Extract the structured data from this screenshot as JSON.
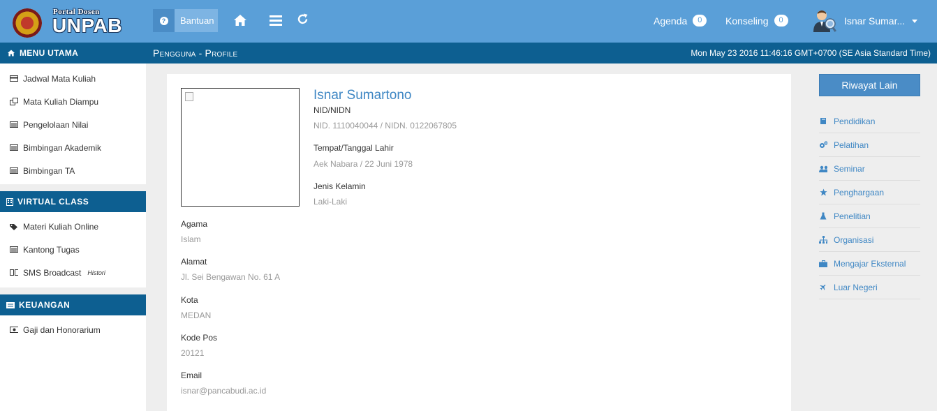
{
  "header": {
    "logo_top": "Portal Dosen",
    "logo_main": "UNPAB",
    "help_label": "Bantuan",
    "agenda_label": "Agenda",
    "agenda_count": "0",
    "konseling_label": "Konseling",
    "konseling_count": "0",
    "user_name": "Isnar Sumar..."
  },
  "subbar": {
    "menu_title": "MENU UTAMA",
    "page_title_a": "Pengguna",
    "page_title_sep": " - ",
    "page_title_b": "Profile",
    "datetime": "Mon May 23 2016 11:46:16 GMT+0700 (SE Asia Standard Time)"
  },
  "sidebar": {
    "main_items": [
      {
        "label": "Jadwal Mata Kuliah",
        "icon": "card-icon"
      },
      {
        "label": "Mata Kuliah Diampu",
        "icon": "copy-icon"
      },
      {
        "label": "Pengelolaan Nilai",
        "icon": "list-icon"
      },
      {
        "label": "Bimbingan Akademik",
        "icon": "list-icon"
      },
      {
        "label": "Bimbingan TA",
        "icon": "list-icon"
      }
    ],
    "virtual_title": "VIRTUAL CLASS",
    "virtual_items": [
      {
        "label": "Materi Kuliah Online",
        "icon": "tags-icon"
      },
      {
        "label": "Kantong Tugas",
        "icon": "list-icon"
      },
      {
        "label": "SMS Broadcast",
        "icon": "phone-icon",
        "tag": "Histori"
      }
    ],
    "keuangan_title": "KEUANGAN",
    "keuangan_items": [
      {
        "label": "Gaji dan Honorarium",
        "icon": "money-icon"
      }
    ]
  },
  "profile": {
    "name": "Isnar Sumartono",
    "nid_label": "NID/NIDN",
    "nid_value": "NID. 1110040044 / NIDN. 0122067805",
    "ttl_label": "Tempat/Tanggal Lahir",
    "ttl_value": "Aek Nabara / 22 Juni 1978",
    "jk_label": "Jenis Kelamin",
    "jk_value": "Laki-Laki",
    "agama_label": "Agama",
    "agama_value": "Islam",
    "alamat_label": "Alamat",
    "alamat_value": "Jl. Sei Bengawan No. 61 A",
    "kota_label": "Kota",
    "kota_value": "MEDAN",
    "kodepos_label": "Kode Pos",
    "kodepos_value": "20121",
    "email_label": "Email",
    "email_value": "isnar@pancabudi.ac.id"
  },
  "right_panel": {
    "button_label": "Riwayat Lain",
    "items": [
      {
        "label": "Pendidikan",
        "icon": "book-icon"
      },
      {
        "label": "Pelatihan",
        "icon": "cogs-icon"
      },
      {
        "label": "Seminar",
        "icon": "users-icon"
      },
      {
        "label": "Penghargaan",
        "icon": "star-icon"
      },
      {
        "label": "Penelitian",
        "icon": "flask-icon"
      },
      {
        "label": "Organisasi",
        "icon": "sitemap-icon"
      },
      {
        "label": "Mengajar Eksternal",
        "icon": "briefcase-icon"
      },
      {
        "label": "Luar Negeri",
        "icon": "plane-icon"
      }
    ]
  },
  "colors": {
    "topbar": "#5a9fd8",
    "darkbar": "#0d5f91",
    "accent": "#3f87c4"
  }
}
